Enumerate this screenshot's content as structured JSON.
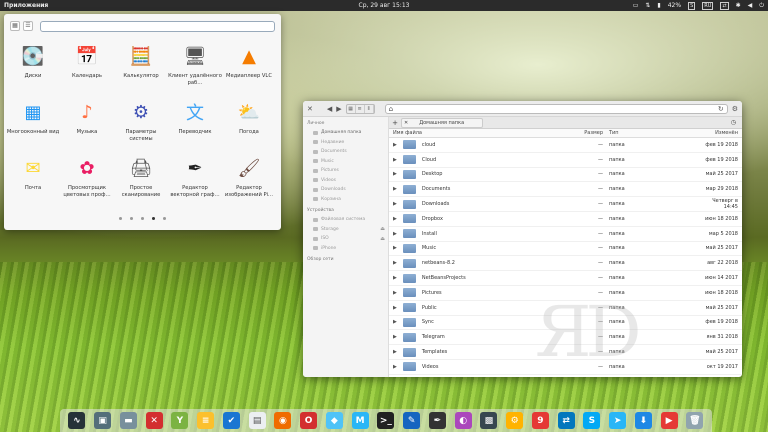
{
  "topbar": {
    "apps": "Приложения",
    "clock": "Ср, 29 авг   15:13",
    "battery": "42%",
    "indicators": [
      "🗂",
      "📶",
      "ru",
      "🔊",
      "✱",
      "🔋",
      "42%",
      "S",
      "RU",
      "⇅",
      "🔊",
      "⏻"
    ]
  },
  "launcher": {
    "apps": [
      {
        "label": "Диски",
        "icon": "disk-icon",
        "glyph": "💽",
        "color": "#777"
      },
      {
        "label": "Календарь",
        "icon": "calendar-icon",
        "glyph": "📅",
        "color": "#8bc34a"
      },
      {
        "label": "Калькулятор",
        "icon": "calculator-icon",
        "glyph": "🧮",
        "color": "#999"
      },
      {
        "label": "Клиент удалённого раб…",
        "icon": "remote-desktop-icon",
        "glyph": "🖥",
        "color": "#555"
      },
      {
        "label": "Медиаплеер VLC",
        "icon": "vlc-icon",
        "glyph": "▲",
        "color": "#f57c00"
      },
      {
        "label": "Многооконный вид",
        "icon": "multitasking-icon",
        "glyph": "▦",
        "color": "#2196f3"
      },
      {
        "label": "Музыка",
        "icon": "music-icon",
        "glyph": "♪",
        "color": "#ff7043"
      },
      {
        "label": "Параметры системы",
        "icon": "settings-icon",
        "glyph": "⚙",
        "color": "#3f51b5"
      },
      {
        "label": "Переводчик",
        "icon": "translator-icon",
        "glyph": "文",
        "color": "#42a5f5"
      },
      {
        "label": "Погода",
        "icon": "weather-icon",
        "glyph": "⛅",
        "color": "#fbc02d"
      },
      {
        "label": "Почта",
        "icon": "mail-icon",
        "glyph": "✉",
        "color": "#fdd835"
      },
      {
        "label": "Просмотрщик цветовых проф…",
        "icon": "color-profile-icon",
        "glyph": "✿",
        "color": "#e91e63"
      },
      {
        "label": "Простое сканирование",
        "icon": "scanner-icon",
        "glyph": "🖨",
        "color": "#555"
      },
      {
        "label": "Редактор векторной граф…",
        "icon": "inkscape-icon",
        "glyph": "✒",
        "color": "#222"
      },
      {
        "label": "Редактор изображений Pi…",
        "icon": "pinta-icon",
        "glyph": "🖌",
        "color": "#6d4c41"
      }
    ],
    "pages": 5,
    "active_page": 4
  },
  "filemanager": {
    "path": "",
    "tab_label": "Домашняя папка",
    "sidebar": {
      "personal_header": "Личное",
      "personal": [
        "Домашняя папка",
        "Недавние",
        "Documents",
        "Music",
        "Pictures",
        "Videos",
        "Downloads",
        "Корзина"
      ],
      "devices_header": "Устройства",
      "devices": [
        "Файловая система",
        "Storage",
        "ISO",
        "iPhone"
      ],
      "network_header": "Обзор сети"
    },
    "columns": {
      "name": "Имя файла",
      "size": "Размер",
      "type": "Тип",
      "modified": "Изменён"
    },
    "files": [
      {
        "name": "cloud",
        "size": "—",
        "type": "папка",
        "modified": "фев 19 2018"
      },
      {
        "name": "Cloud",
        "size": "—",
        "type": "папка",
        "modified": "фев 19 2018"
      },
      {
        "name": "Desktop",
        "size": "—",
        "type": "папка",
        "modified": "май 25 2017"
      },
      {
        "name": "Documents",
        "size": "—",
        "type": "папка",
        "modified": "мар 29 2018"
      },
      {
        "name": "Downloads",
        "size": "—",
        "type": "папка",
        "modified": "Четверг в 14:45"
      },
      {
        "name": "Dropbox",
        "size": "—",
        "type": "папка",
        "modified": "июн 18 2018"
      },
      {
        "name": "Install",
        "size": "—",
        "type": "папка",
        "modified": "мар 5 2018"
      },
      {
        "name": "Music",
        "size": "—",
        "type": "папка",
        "modified": "май 25 2017"
      },
      {
        "name": "netbeans-8.2",
        "size": "—",
        "type": "папка",
        "modified": "авг 22 2018"
      },
      {
        "name": "NetBeansProjects",
        "size": "—",
        "type": "папка",
        "modified": "июн 14 2017"
      },
      {
        "name": "Pictures",
        "size": "—",
        "type": "папка",
        "modified": "июн 18 2018"
      },
      {
        "name": "Public",
        "size": "—",
        "type": "папка",
        "modified": "май 25 2017"
      },
      {
        "name": "Sync",
        "size": "—",
        "type": "папка",
        "modified": "фев 19 2018"
      },
      {
        "name": "Telegram",
        "size": "—",
        "type": "папка",
        "modified": "янв 31 2018"
      },
      {
        "name": "Templates",
        "size": "—",
        "type": "папка",
        "modified": "май 25 2017"
      },
      {
        "name": "Videos",
        "size": "—",
        "type": "папка",
        "modified": "окт 19 2017"
      }
    ]
  },
  "dock": [
    {
      "name": "system-monitor-icon",
      "glyph": "∿",
      "color": "#263238"
    },
    {
      "name": "floppy-icon",
      "glyph": "▣",
      "color": "#546e7a"
    },
    {
      "name": "files-icon",
      "glyph": "▬",
      "color": "#78909c"
    },
    {
      "name": "crossover-icon",
      "glyph": "✕",
      "color": "#d32f2f"
    },
    {
      "name": "evernote-icon",
      "glyph": "Y",
      "color": "#7cb342"
    },
    {
      "name": "notes-icon",
      "glyph": "≡",
      "color": "#fbc02d"
    },
    {
      "name": "tasks-icon",
      "glyph": "✔",
      "color": "#1976d2"
    },
    {
      "name": "document-viewer-icon",
      "glyph": "▤",
      "color": "#eceff1"
    },
    {
      "name": "firefox-icon",
      "glyph": "◉",
      "color": "#ef6c00"
    },
    {
      "name": "opera-icon",
      "glyph": "O",
      "color": "#d32f2f"
    },
    {
      "name": "cube-icon",
      "glyph": "◆",
      "color": "#4fc3f7"
    },
    {
      "name": "mail-app-icon",
      "glyph": "M",
      "color": "#29b6f6"
    },
    {
      "name": "terminal-icon",
      "glyph": ">_",
      "color": "#212121"
    },
    {
      "name": "text-editor-icon",
      "glyph": "✎",
      "color": "#1565c0"
    },
    {
      "name": "inkscape-dock-icon",
      "glyph": "✒",
      "color": "#333"
    },
    {
      "name": "color-picker-icon",
      "glyph": "◐",
      "color": "#ab47bc"
    },
    {
      "name": "screenshot-icon",
      "glyph": "▩",
      "color": "#37474f"
    },
    {
      "name": "system-tool-icon",
      "glyph": "⚙",
      "color": "#ffb300"
    },
    {
      "name": "yandex-icon",
      "glyph": "9",
      "color": "#e53935"
    },
    {
      "name": "network-icon",
      "glyph": "⇄",
      "color": "#0277bd"
    },
    {
      "name": "skype-icon",
      "glyph": "S",
      "color": "#03a9f4"
    },
    {
      "name": "telegram-icon",
      "glyph": "➤",
      "color": "#29b6f6"
    },
    {
      "name": "download-icon",
      "glyph": "⬇",
      "color": "#1e88e5"
    },
    {
      "name": "youtube-icon",
      "glyph": "▶",
      "color": "#e53935"
    },
    {
      "name": "trash-icon",
      "glyph": "🗑",
      "color": "#90a4ae"
    }
  ]
}
